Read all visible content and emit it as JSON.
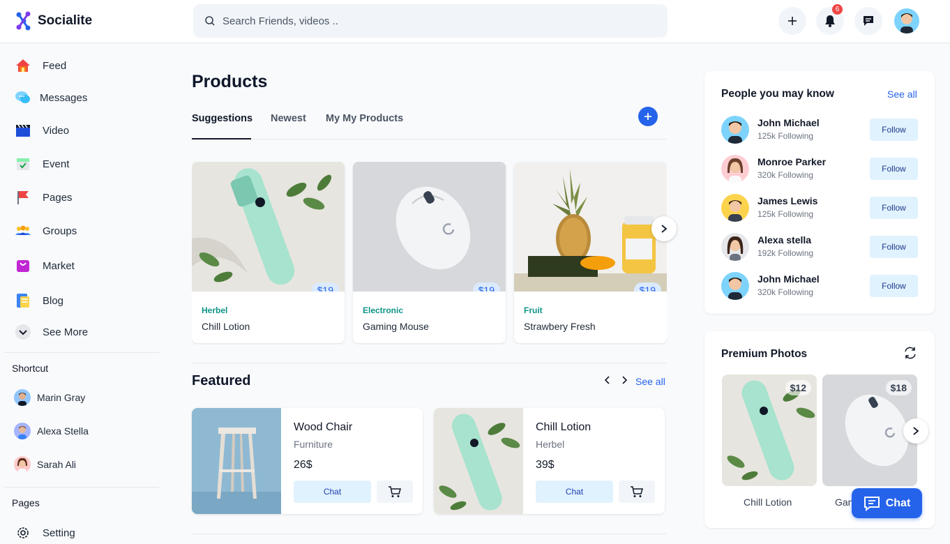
{
  "app": {
    "name": "Socialite"
  },
  "header": {
    "search_placeholder": "Search Friends, videos ..",
    "notification_count": "6"
  },
  "sidebar": {
    "items": [
      {
        "label": "Feed",
        "icon": "home-icon"
      },
      {
        "label": "Messages",
        "icon": "messages-icon"
      },
      {
        "label": "Video",
        "icon": "video-icon"
      },
      {
        "label": "Event",
        "icon": "calendar-icon"
      },
      {
        "label": "Pages",
        "icon": "flag-icon"
      },
      {
        "label": "Groups",
        "icon": "groups-icon"
      },
      {
        "label": "Market",
        "icon": "bag-icon"
      },
      {
        "label": "Blog",
        "icon": "blog-icon"
      },
      {
        "label": "See More",
        "icon": "chevron-down-icon"
      }
    ],
    "shortcut_title": "Shortcut",
    "shortcuts": [
      {
        "label": "Marin Gray"
      },
      {
        "label": "Alexa Stella"
      },
      {
        "label": "Sarah Ali"
      }
    ],
    "pages_title": "Pages",
    "setting_label": "Setting"
  },
  "main": {
    "title": "Products",
    "tabs": [
      {
        "label": "Suggestions",
        "active": true
      },
      {
        "label": "Newest",
        "active": false
      },
      {
        "label": "My My Products",
        "active": false
      }
    ],
    "products": [
      {
        "category": "Herbel",
        "name": "Chill Lotion",
        "price": "$19"
      },
      {
        "category": "Electronic",
        "name": "Gaming Mouse",
        "price": "$19"
      },
      {
        "category": "Fruit",
        "name": "Strawbery Fresh",
        "price": "$19"
      }
    ],
    "featured_title": "Featured",
    "see_all": "See all",
    "featured": [
      {
        "name": "Wood Chair",
        "category": "Furniture",
        "price": "26$",
        "chat": "Chat"
      },
      {
        "name": "Chill Lotion",
        "category": "Herbel",
        "price": "39$",
        "chat": "Chat"
      }
    ]
  },
  "right": {
    "people_title": "People you may know",
    "see_all": "See all",
    "people": [
      {
        "name": "John Michael",
        "following": "125k Following",
        "button": "Follow"
      },
      {
        "name": "Monroe Parker",
        "following": "320k Following",
        "button": "Follow"
      },
      {
        "name": "James Lewis",
        "following": "125k Following",
        "button": "Follow"
      },
      {
        "name": "Alexa stella",
        "following": "192k Following",
        "button": "Follow"
      },
      {
        "name": "John Michael",
        "following": "320k Following",
        "button": "Follow"
      }
    ],
    "photos_title": "Premium Photos",
    "photos": [
      {
        "label": "Chill Lotion",
        "price": "$12"
      },
      {
        "label": "Gan",
        "price": "$18"
      }
    ]
  },
  "float_chat": {
    "label": "Chat"
  },
  "colors": {
    "accent": "#2563eb",
    "badge": "#ef4444"
  }
}
